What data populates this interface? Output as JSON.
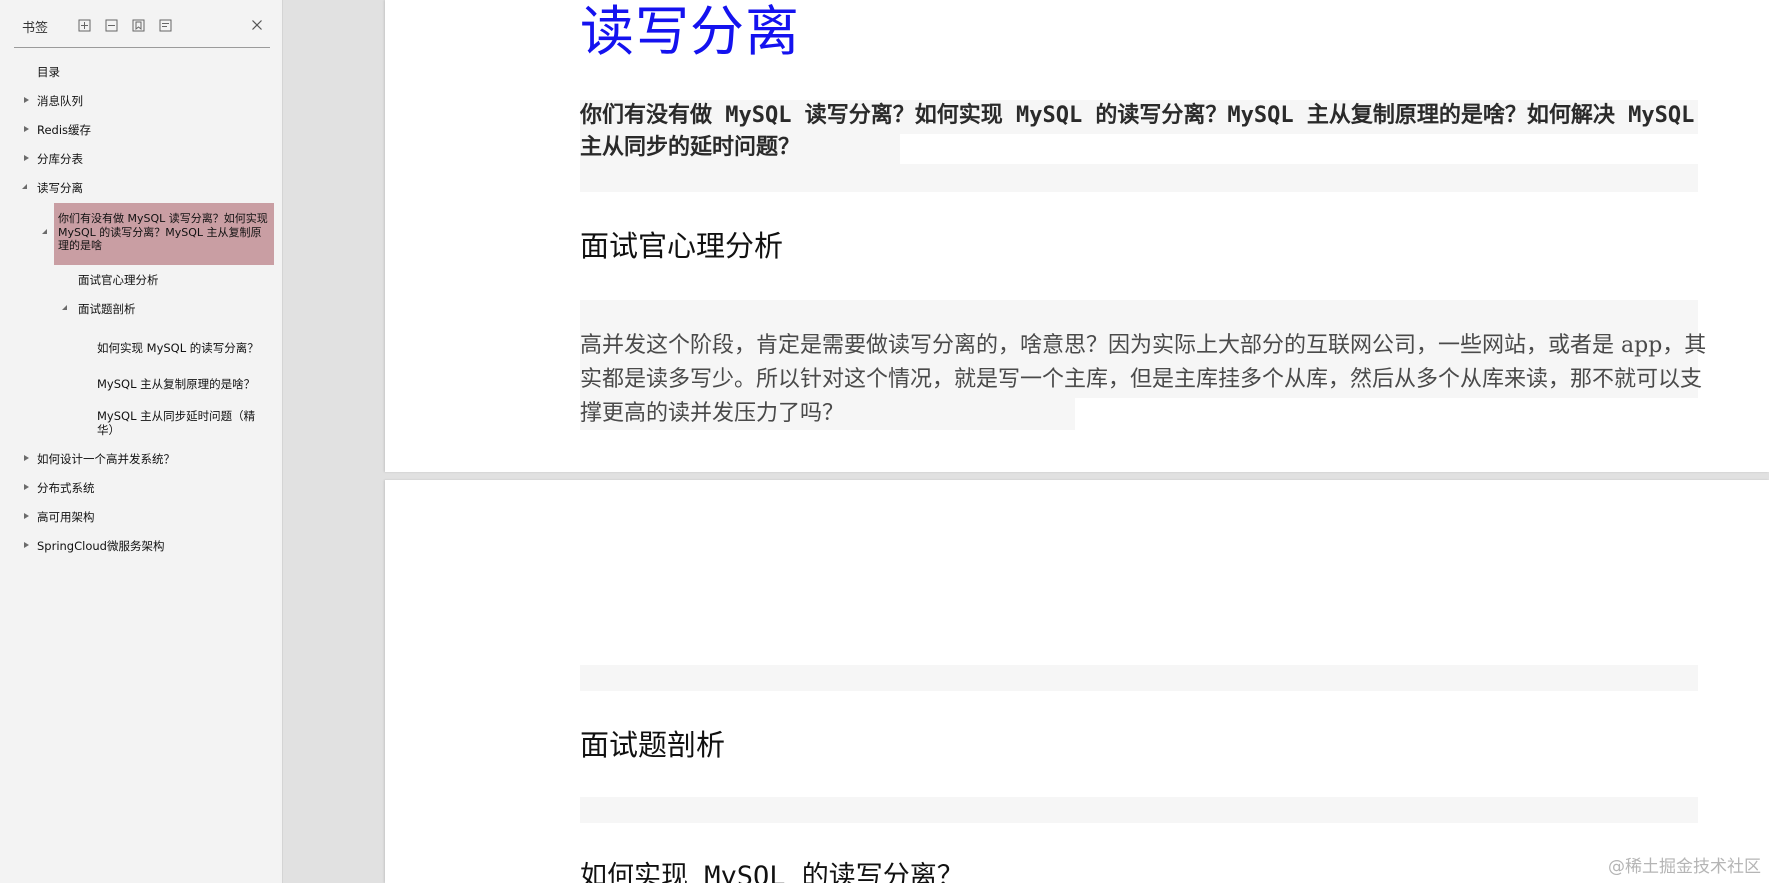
{
  "sidebar": {
    "title": "书签",
    "toolbar_icons": [
      "expand-all-icon",
      "collapse-all-icon",
      "add-bookmark-icon",
      "bookmark-properties-icon"
    ],
    "close_icon": "close-icon",
    "items": [
      {
        "label": "目录"
      },
      {
        "label": "消息队列"
      },
      {
        "label": "Redis缓存"
      },
      {
        "label": "分库分表"
      },
      {
        "label": "读写分离"
      },
      {
        "label": "你们有没有做 MySQL 读写分离？如何实现 MySQL 的读写分离？MySQL 主从复制原理的是啥"
      },
      {
        "label": "面试官心理分析"
      },
      {
        "label": "面试题剖析"
      },
      {
        "label": "如何实现 MySQL 的读写分离？"
      },
      {
        "label": "MySQL 主从复制原理的是啥？"
      },
      {
        "label": "MySQL 主从同步延时问题（精华）"
      },
      {
        "label": "如何设计一个高并发系统？"
      },
      {
        "label": "分布式系统"
      },
      {
        "label": "高可用架构"
      },
      {
        "label": "SpringCloud微服务架构"
      }
    ],
    "selected_color": "#c99ea3"
  },
  "document": {
    "title": "读写分离",
    "title_color": "#1412ef",
    "question": "你们有没有做 MySQL 读写分离？如何实现 MySQL 的读写分离？MySQL 主从复制原理的是啥？如何解决 MySQL 主从同步的延时问题？",
    "section1_heading": "面试官心理分析",
    "section1_paragraph": "高并发这个阶段，肯定是需要做读写分离的，啥意思？因为实际上大部分的互联网公司，一些网站，或者是 app，其实都是读多写少。所以针对这个情况，就是写一个主库，但是主库挂多个从库，然后从多个从库来读，那不就可以支撑更高的读并发压力了吗？",
    "section2_heading": "面试题剖析",
    "section3_heading": "如何实现 MySQL 的读写分离？"
  },
  "watermark": "@稀土掘金技术社区"
}
